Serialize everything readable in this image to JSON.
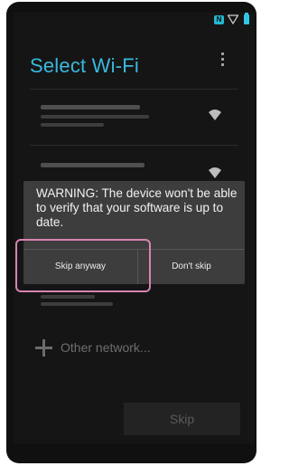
{
  "status_bar": {
    "nfc_label": "N"
  },
  "header": {
    "title": "Select Wi-Fi"
  },
  "dialog": {
    "message": "WARNING: The device won't be able to verify that your software is up to date.",
    "skip_anyway_label": "Skip anyway",
    "dont_skip_label": "Don't skip"
  },
  "other_network": {
    "label": "Other network..."
  },
  "footer": {
    "skip_label": "Skip"
  },
  "colors": {
    "accent": "#39b9dd",
    "highlight_border": "#d883b0",
    "dialog_bg": "#3d3d3d"
  }
}
